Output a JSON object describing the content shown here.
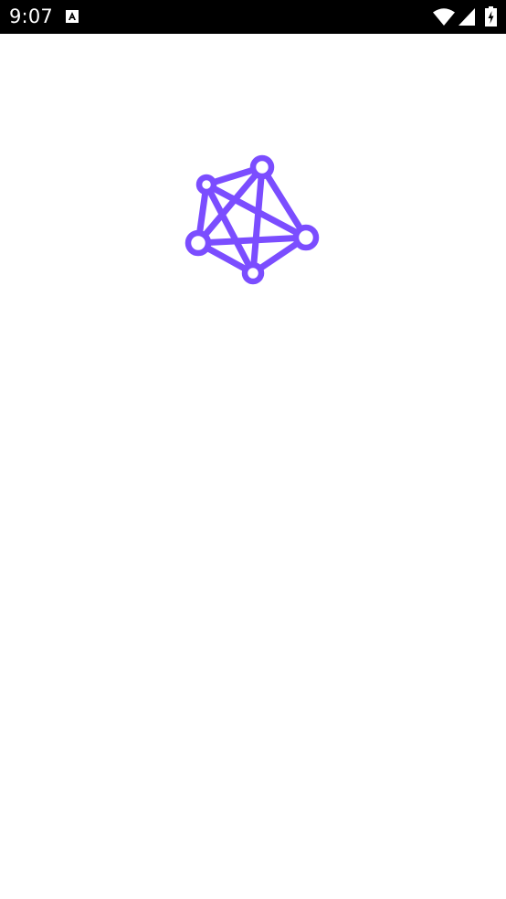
{
  "status_bar": {
    "time": "9:07",
    "icons": [
      "notification-a-icon",
      "wifi-icon",
      "signal-icon",
      "battery-charging-icon"
    ],
    "background_color": "#000000",
    "foreground_color": "#ffffff"
  },
  "splash": {
    "background_color": "#ffffff",
    "logo_icon": "network-nodes-icon",
    "logo_color": "#7b4dff"
  }
}
